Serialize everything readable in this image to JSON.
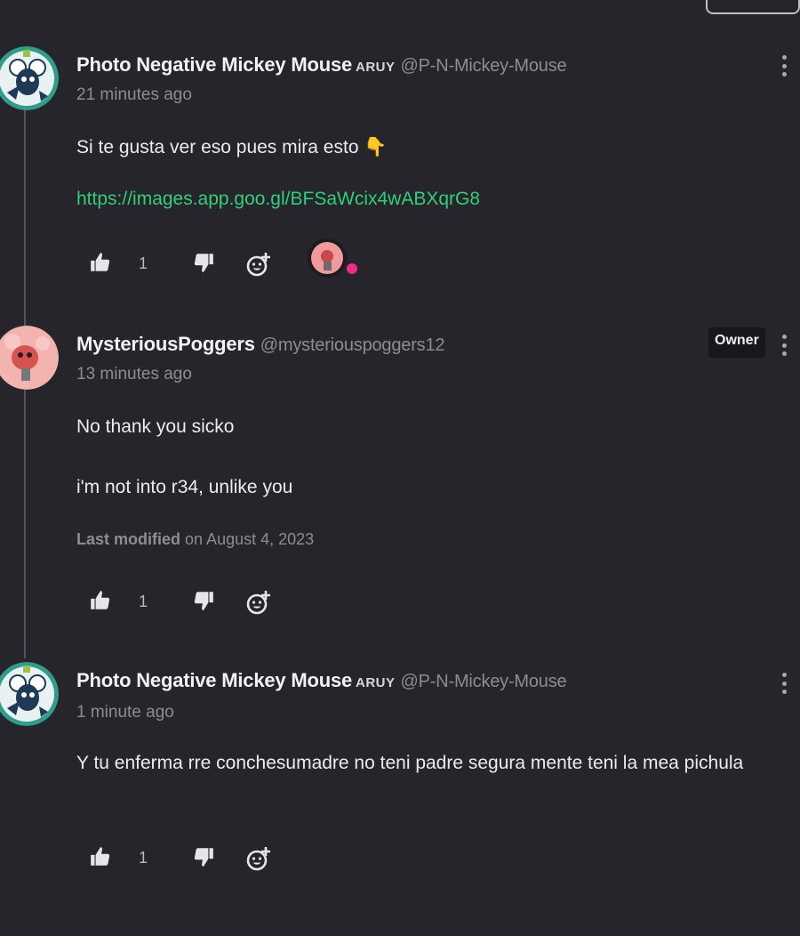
{
  "colors": {
    "background": "#26252b",
    "link": "#2fd07a",
    "muted": "#8d8c94",
    "reaction_dot": "#ef2b86"
  },
  "comments": [
    {
      "username": "Photo Negative Mickey Mouse",
      "badge": "ARUY",
      "handle": "@P-N-Mickey-Mouse",
      "time": "21 minutes ago",
      "body": [
        "Si te gusta ver eso pues mira esto 👇"
      ],
      "link": "https://images.app.goo.gl/BFSaWcix4wABXqrG8",
      "likes": "1",
      "icons": [
        "thumbs-up-icon",
        "thumbs-down-icon",
        "add-reaction-icon",
        "more-vertical-icon"
      ]
    },
    {
      "username": "MysteriousPoggers",
      "handle": "@mysteriouspoggers12",
      "owner_label": "Owner",
      "time": "13 minutes ago",
      "body": [
        "No thank you sicko",
        "i'm not into r34, unlike you"
      ],
      "modified_label": "Last modified",
      "modified_on": "on August 4, 2023",
      "likes": "1"
    },
    {
      "username": "Photo Negative Mickey Mouse",
      "badge": "ARUY",
      "handle": "@P-N-Mickey-Mouse",
      "time": "1 minute ago",
      "body": [
        "Y tu enferma rre conchesumadre no teni padre segura mente teni la mea pichula"
      ],
      "likes": "1"
    }
  ]
}
